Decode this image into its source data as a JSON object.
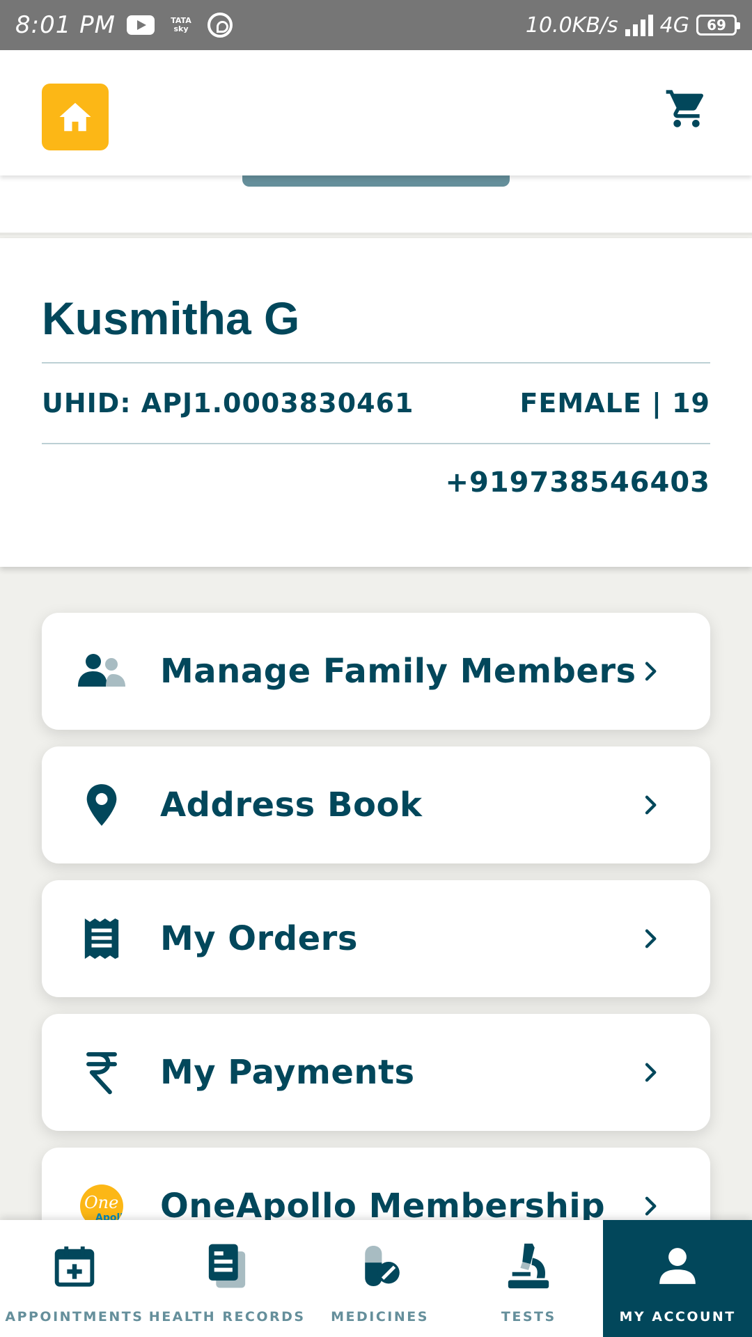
{
  "status_bar": {
    "time": "8:01 PM",
    "network_speed": "10.0KB/s",
    "network_type": "4G",
    "battery_level": "69",
    "tatasky_label": "TATA sky"
  },
  "header": {
    "home_icon": "home-icon",
    "cart_icon": "cart-icon"
  },
  "profile": {
    "name": "Kusmitha G",
    "uhid": "UHID: APJ1.0003830461",
    "gender_age": "FEMALE | 19",
    "phone": "+919738546403"
  },
  "menu": {
    "items": [
      {
        "label": "Manage Family Members",
        "icon": "family-icon"
      },
      {
        "label": "Address Book",
        "icon": "location-pin-icon"
      },
      {
        "label": "My Orders",
        "icon": "receipt-icon"
      },
      {
        "label": "My Payments",
        "icon": "rupee-icon"
      },
      {
        "label": "OneApollo Membership",
        "icon": "oneapollo-logo"
      }
    ]
  },
  "bottom_nav": {
    "items": [
      {
        "label": "APPOINTMENTS",
        "icon": "calendar-plus-icon",
        "active": false
      },
      {
        "label": "HEALTH RECORDS",
        "icon": "health-records-icon",
        "active": false
      },
      {
        "label": "MEDICINES",
        "icon": "medicines-icon",
        "active": false
      },
      {
        "label": "TESTS",
        "icon": "microscope-icon",
        "active": false
      },
      {
        "label": "MY ACCOUNT",
        "icon": "account-icon",
        "active": true
      }
    ]
  },
  "colors": {
    "primary": "#02475b",
    "accent": "#fcb716",
    "muted": "#658f9b",
    "background": "#f0f0ec"
  }
}
